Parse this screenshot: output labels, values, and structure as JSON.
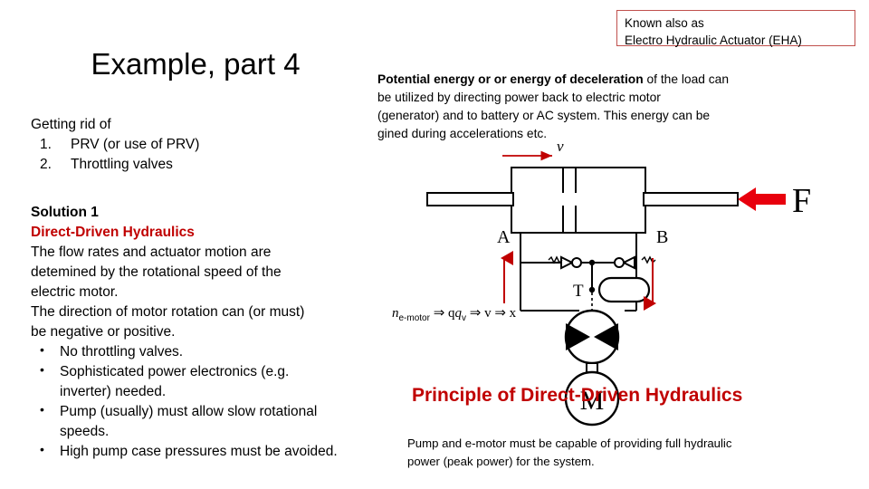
{
  "slide": {
    "title": "Example, part 4",
    "background": "#ffffff",
    "accent_dark_red": "#C00000",
    "accent_bright_red": "#E8000D",
    "callout_border": "#C0504D"
  },
  "getting_rid": {
    "lead": "Getting rid of",
    "items": [
      {
        "num": "1.",
        "text": "PRV (or use of PRV)"
      },
      {
        "num": "2.",
        "text": "Throttling valves"
      }
    ]
  },
  "solution": {
    "heading": "Solution 1",
    "subheading": "Direct-Driven Hydraulics",
    "paragraph_lines": [
      "The flow rates and actuator motion are",
      "detemined by the rotational speed of the",
      "electric motor.",
      "The direction of motor rotation can (or must)",
      "be negative or positive."
    ],
    "bullets": [
      {
        "bullet": "•",
        "lines": [
          "No throttling valves."
        ]
      },
      {
        "bullet": "•",
        "lines": [
          "Sophisticated power electronics (e.g.",
          "inverter) needed."
        ]
      },
      {
        "bullet": "•",
        "lines": [
          "Pump (usually) must allow slow rotational",
          "speeds."
        ]
      },
      {
        "bullet": "•",
        "lines": [
          "High pump case pressures must be avoided."
        ]
      }
    ]
  },
  "callout": {
    "line1": "Known also as",
    "line2": "Electro Hydraulic Actuator (EHA)"
  },
  "energy_paragraph": {
    "bold_part": "Potential energy or or energy of deceleration",
    "rest_line1": " of the load can",
    "line2": "be utilized by directing power back to electric motor",
    "line3": "(generator) and to battery or AC system. This energy can be",
    "line4": "gined during accelerations etc."
  },
  "diagram": {
    "velocity_label": "v",
    "force_label": "F",
    "port_a_label": "A",
    "port_b_label": "B",
    "tank_label": "T",
    "motor_label": "M",
    "chain_formula": "n",
    "chain_sub": "e-motor",
    "chain_rest": " ⇒ q",
    "chain_sub2": "v",
    "chain_rest2": " ⇒ v ⇒ x"
  },
  "footer": {
    "principle_heading": "Principle of Direct-Driven Hydraulics",
    "note_line1": "Pump and e-motor must be capable of providing full hydraulic",
    "note_line2": "power (peak power) for the system."
  }
}
